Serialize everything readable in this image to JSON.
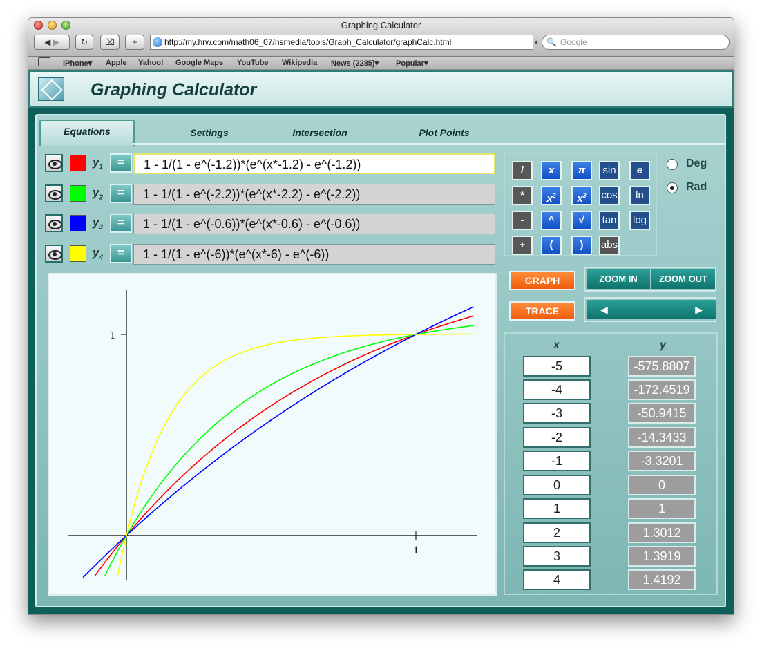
{
  "browser": {
    "window_title": "Graphing Calculator",
    "url": "http://my.hrw.com/math06_07/nsmedia/tools/Graph_Calculator/graphCalc.html",
    "search_placeholder": "Google",
    "bookmarks": [
      "iPhone",
      "Apple",
      "Yahoo!",
      "Google Maps",
      "YouTube",
      "Wikipedia",
      "News (2285)",
      "Popular"
    ]
  },
  "app": {
    "title": "Graphing Calculator",
    "tabs": [
      "Equations",
      "Settings",
      "Intersection",
      "Plot Points"
    ],
    "active_tab": "Equations"
  },
  "equations": [
    {
      "label": "y",
      "index": "1",
      "expr": "1 - 1/(1 - e^(-1.2))*(e^(x*-1.2) - e^(-1.2))",
      "color": "#ff0000",
      "k": -1.2
    },
    {
      "label": "y",
      "index": "2",
      "expr": "1 - 1/(1 - e^(-2.2))*(e^(x*-2.2) - e^(-2.2))",
      "color": "#00ff00",
      "k": -2.2
    },
    {
      "label": "y",
      "index": "3",
      "expr": "1 - 1/(1 - e^(-0.6))*(e^(x*-0.6) - e^(-0.6))",
      "color": "#0000ff",
      "k": -0.6
    },
    {
      "label": "y",
      "index": "4",
      "expr": "1 - 1/(1 - e^(-6))*(e^(x*-6) - e^(-6))",
      "color": "#ffff00",
      "k": -6
    }
  ],
  "keypad": {
    "rows": [
      [
        "/",
        "x",
        "π",
        "sin",
        "e"
      ],
      [
        "*",
        "x2",
        "x3",
        "cos",
        "ln"
      ],
      [
        "-",
        "^",
        "√",
        "tan",
        "log"
      ],
      [
        "+",
        "(",
        ")",
        "abs"
      ]
    ]
  },
  "angle_mode": {
    "deg_label": "Deg",
    "rad_label": "Rad",
    "selected": "Rad"
  },
  "controls": {
    "graph_label": "GRAPH",
    "trace_label": "TRACE",
    "zoom_in_label": "ZOOM IN",
    "zoom_out_label": "ZOOM OUT",
    "left_arrow": "◀",
    "right_arrow": "▶"
  },
  "table": {
    "x_header": "x",
    "y_header": "y",
    "rows": [
      {
        "x": "-5",
        "y": "-575.8807"
      },
      {
        "x": "-4",
        "y": "-172.4519"
      },
      {
        "x": "-3",
        "y": "-50.9415"
      },
      {
        "x": "-2",
        "y": "-14.3433"
      },
      {
        "x": "-1",
        "y": "-3.3201"
      },
      {
        "x": "0",
        "y": "0"
      },
      {
        "x": "1",
        "y": "1"
      },
      {
        "x": "2",
        "y": "1.3012"
      },
      {
        "x": "3",
        "y": "1.3919"
      },
      {
        "x": "4",
        "y": "1.4192"
      }
    ]
  },
  "chart_data": {
    "type": "line",
    "xlim": [
      -0.2,
      1.2
    ],
    "ylim": [
      -0.2,
      1.2
    ],
    "x_tick_label": "1",
    "y_tick_label": "1",
    "grid": false,
    "series": [
      {
        "k": -1.2,
        "color": "#ff0000",
        "x": [
          -0.12,
          0,
          0.25,
          0.5,
          0.75,
          1,
          1.2
        ],
        "y": [
          -0.2,
          0,
          0.368,
          0.638,
          0.837,
          1,
          1.11
        ]
      },
      {
        "k": -2.2,
        "color": "#00ff00",
        "x": [
          -0.07,
          0,
          0.25,
          0.5,
          0.75,
          1,
          1.2
        ],
        "y": [
          -0.2,
          0,
          0.473,
          0.749,
          0.902,
          1,
          1.045
        ]
      },
      {
        "k": -0.6,
        "color": "#0000ff",
        "x": [
          -0.14,
          0,
          0.25,
          0.5,
          0.75,
          1,
          1.2
        ],
        "y": [
          -0.2,
          0,
          0.308,
          0.573,
          0.802,
          1,
          1.145
        ]
      },
      {
        "k": -6,
        "color": "#ffff00",
        "x": [
          -0.03,
          0,
          0.25,
          0.5,
          0.75,
          1,
          1.2
        ],
        "y": [
          -0.2,
          0,
          0.779,
          0.952,
          0.991,
          1,
          1.002
        ]
      }
    ]
  }
}
